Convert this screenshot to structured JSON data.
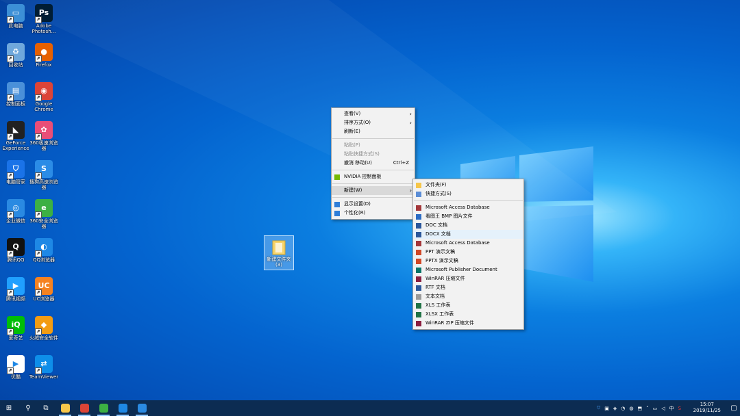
{
  "desktop_icons": [
    {
      "label": "此电脑",
      "color": "#3c8fd6",
      "glyph": "▭"
    },
    {
      "label": "Adobe Photosh...",
      "color": "#001d34",
      "glyph": "Ps"
    },
    {
      "label": "回收站",
      "color": "#6fa8dc",
      "glyph": "♻"
    },
    {
      "label": "Firefox",
      "color": "#e66000",
      "glyph": "●"
    },
    {
      "label": "控制面板",
      "color": "#4a90d9",
      "glyph": "▤"
    },
    {
      "label": "Google Chrome",
      "color": "#db4437",
      "glyph": "◉"
    },
    {
      "label": "GeForce Experience",
      "color": "#222222",
      "glyph": "◣"
    },
    {
      "label": "360极速浏览器",
      "color": "#e94e77",
      "glyph": "✿"
    },
    {
      "label": "电脑管家",
      "color": "#1a73e8",
      "glyph": "⛉"
    },
    {
      "label": "搜狗高速浏览器",
      "color": "#2b8ce6",
      "glyph": "S"
    },
    {
      "label": "企业微信",
      "color": "#2a8ae2",
      "glyph": "◎"
    },
    {
      "label": "360安全浏览器",
      "color": "#3cb043",
      "glyph": "e"
    },
    {
      "label": "腾讯QQ",
      "color": "#111111",
      "glyph": "Q"
    },
    {
      "label": "QQ浏览器",
      "color": "#1e88e5",
      "glyph": "◐"
    },
    {
      "label": "腾讯视频",
      "color": "#20a0ff",
      "glyph": "▶"
    },
    {
      "label": "UC浏览器",
      "color": "#f58220",
      "glyph": "UC"
    },
    {
      "label": "爱奇艺",
      "color": "#00be06",
      "glyph": "iQ"
    },
    {
      "label": "火绒安全软件",
      "color": "#f39c12",
      "glyph": "◆"
    },
    {
      "label": "优酷",
      "color": "#ffffff",
      "glyph": "▶"
    },
    {
      "label": "TeamViewer",
      "color": "#0e8ee9",
      "glyph": "⇄"
    }
  ],
  "folder": {
    "label": "新建文件夹(3)"
  },
  "context_menu": {
    "items": [
      {
        "label": "查看(V)",
        "submenu": true
      },
      {
        "label": "排序方式(O)",
        "submenu": true
      },
      {
        "label": "刷新(E)"
      },
      {
        "sep": true
      },
      {
        "label": "粘贴(P)",
        "disabled": true
      },
      {
        "label": "粘贴快捷方式(S)",
        "disabled": true
      },
      {
        "label": "撤消 移动(U)",
        "accel": "Ctrl+Z"
      },
      {
        "sep": true
      },
      {
        "label": "NVIDIA 控制面板",
        "icon": "nvidia-icon",
        "icon_color": "#76b900"
      },
      {
        "sep": true
      },
      {
        "label": "新建(W)",
        "submenu": true,
        "active": true
      },
      {
        "sep": true
      },
      {
        "label": "显示设置(D)",
        "icon": "display-icon",
        "icon_color": "#2f7ed8"
      },
      {
        "label": "个性化(R)",
        "icon": "personalize-icon",
        "icon_color": "#2f7ed8"
      }
    ]
  },
  "new_submenu": {
    "items": [
      {
        "label": "文件夹(F)",
        "icon": "folder-icon",
        "icon_color": "#f6c64a"
      },
      {
        "label": "快捷方式(S)",
        "icon": "shortcut-icon",
        "icon_color": "#5b8dd6"
      },
      {
        "sep": true
      },
      {
        "label": "Microsoft Access Database",
        "icon": "access-icon",
        "icon_color": "#a4373a"
      },
      {
        "label": "看图王 BMP 图片文件",
        "icon": "bmp-icon",
        "icon_color": "#2b6cc4"
      },
      {
        "label": "DOC 文档",
        "icon": "doc-icon",
        "icon_color": "#2b579a"
      },
      {
        "label": "DOCX 文档",
        "icon": "docx-icon",
        "icon_color": "#2b579a",
        "hover": true
      },
      {
        "label": "Microsoft Access Database",
        "icon": "access-icon",
        "icon_color": "#a4373a"
      },
      {
        "label": "PPT 演示文稿",
        "icon": "ppt-icon",
        "icon_color": "#d24726"
      },
      {
        "label": "PPTX 演示文稿",
        "icon": "pptx-icon",
        "icon_color": "#d24726"
      },
      {
        "label": "Microsoft Publisher Document",
        "icon": "publisher-icon",
        "icon_color": "#077568"
      },
      {
        "label": "WinRAR 压缩文件",
        "icon": "winrar-icon",
        "icon_color": "#8b1e3f"
      },
      {
        "label": "RTF 文档",
        "icon": "rtf-icon",
        "icon_color": "#2b579a"
      },
      {
        "label": "文本文档",
        "icon": "text-icon",
        "icon_color": "#9a9a9a"
      },
      {
        "label": "XLS 工作表",
        "icon": "xls-icon",
        "icon_color": "#217346"
      },
      {
        "label": "XLSX 工作表",
        "icon": "xlsx-icon",
        "icon_color": "#217346"
      },
      {
        "label": "WinRAR ZIP 压缩文件",
        "icon": "winrar-zip-icon",
        "icon_color": "#8b1e3f"
      }
    ]
  },
  "taskbar": {
    "start_glyph": "⊞",
    "search_glyph": "⚲",
    "taskview_glyph": "⧉",
    "apps": [
      {
        "name": "file-explorer-icon",
        "color": "#f6c64a"
      },
      {
        "name": "chrome-icon",
        "color": "#db4437"
      },
      {
        "name": "360-browser-icon",
        "color": "#3cb043"
      },
      {
        "name": "qq-browser-icon",
        "color": "#1e88e5"
      },
      {
        "name": "enterprise-wechat-icon",
        "color": "#2a8ae2"
      }
    ],
    "ime": "中",
    "clock_time": "15:07",
    "clock_date": "2019/11/25"
  }
}
